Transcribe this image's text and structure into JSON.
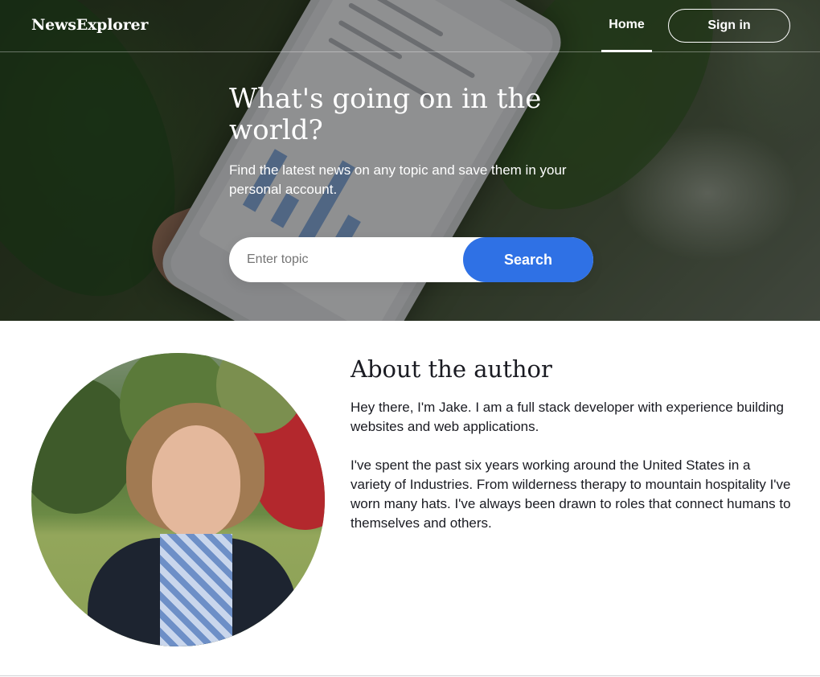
{
  "header": {
    "logo": "NewsExplorer",
    "nav": {
      "home": "Home",
      "sign_in": "Sign in"
    }
  },
  "hero": {
    "title": "What's going on in the world?",
    "subtitle": "Find the latest news on any topic and save them in your personal account.",
    "search": {
      "placeholder": "Enter topic",
      "value": "",
      "button": "Search"
    }
  },
  "about": {
    "title": "About the author",
    "paragraphs": [
      "Hey there, I'm Jake. I am a full stack developer with experience building websites and web applications.",
      "I've spent the past six years working around the United States in a variety of Industries. From wilderness therapy to mountain hospitality I've worn many hats. I've always been drawn to roles that connect humans to themselves and others."
    ]
  },
  "colors": {
    "accent": "#2f71e5",
    "text": "#1a1b22",
    "header_text": "#ffffff"
  }
}
